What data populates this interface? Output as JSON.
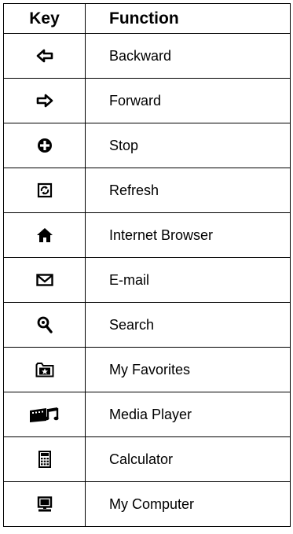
{
  "table": {
    "header_key": "Key",
    "header_function": "Function",
    "rows": [
      {
        "icon": "arrow-left-icon",
        "function": "Backward"
      },
      {
        "icon": "arrow-right-icon",
        "function": "Forward"
      },
      {
        "icon": "stop-icon",
        "function": "Stop"
      },
      {
        "icon": "refresh-icon",
        "function": "Refresh"
      },
      {
        "icon": "home-icon",
        "function": "Internet Browser"
      },
      {
        "icon": "envelope-icon",
        "function": "E-mail"
      },
      {
        "icon": "magnifier-icon",
        "function": "Search"
      },
      {
        "icon": "favorites-folder-icon",
        "function": "My Favorites"
      },
      {
        "icon": "media-player-icon",
        "function": "Media Player"
      },
      {
        "icon": "calculator-icon",
        "function": "Calculator"
      },
      {
        "icon": "computer-icon",
        "function": "My Computer"
      }
    ]
  }
}
